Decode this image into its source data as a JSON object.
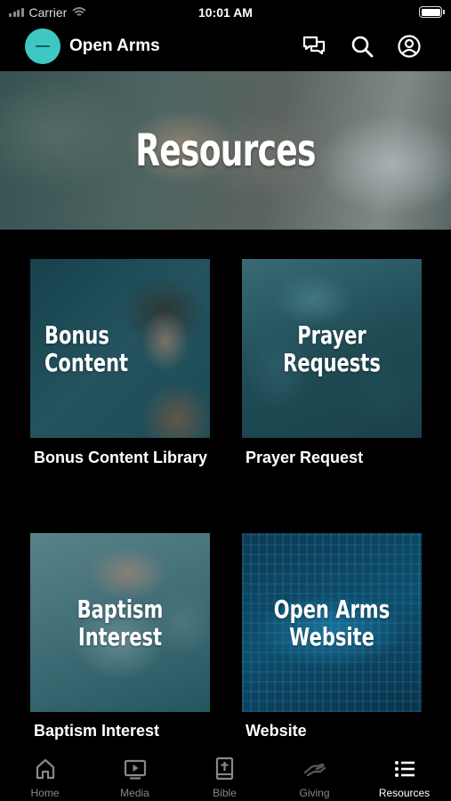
{
  "status_bar": {
    "carrier": "Carrier",
    "time": "10:01 AM"
  },
  "header": {
    "app_name": "Open Arms",
    "icons": [
      "messages-icon",
      "search-icon",
      "profile-icon"
    ]
  },
  "hero": {
    "title": "Resources"
  },
  "resources": [
    {
      "tile_text": "Bonus\nContent",
      "caption": "Bonus Content Library"
    },
    {
      "tile_text": "Prayer\nRequests",
      "caption": "Prayer Request"
    },
    {
      "tile_text": "Baptism\nInterest",
      "caption": "Baptism Interest"
    },
    {
      "tile_text": "Open Arms\nWebsite",
      "caption": "Website"
    }
  ],
  "tab_bar": {
    "tabs": [
      {
        "label": "Home",
        "icon": "home-icon"
      },
      {
        "label": "Media",
        "icon": "play-icon"
      },
      {
        "label": "Bible",
        "icon": "bible-icon"
      },
      {
        "label": "Giving",
        "icon": "giving-icon"
      },
      {
        "label": "Resources",
        "icon": "list-icon"
      }
    ],
    "active": "Resources"
  },
  "colors": {
    "logo": "#3fc7c6",
    "background": "#000000",
    "inactive_tab": "#888888"
  }
}
